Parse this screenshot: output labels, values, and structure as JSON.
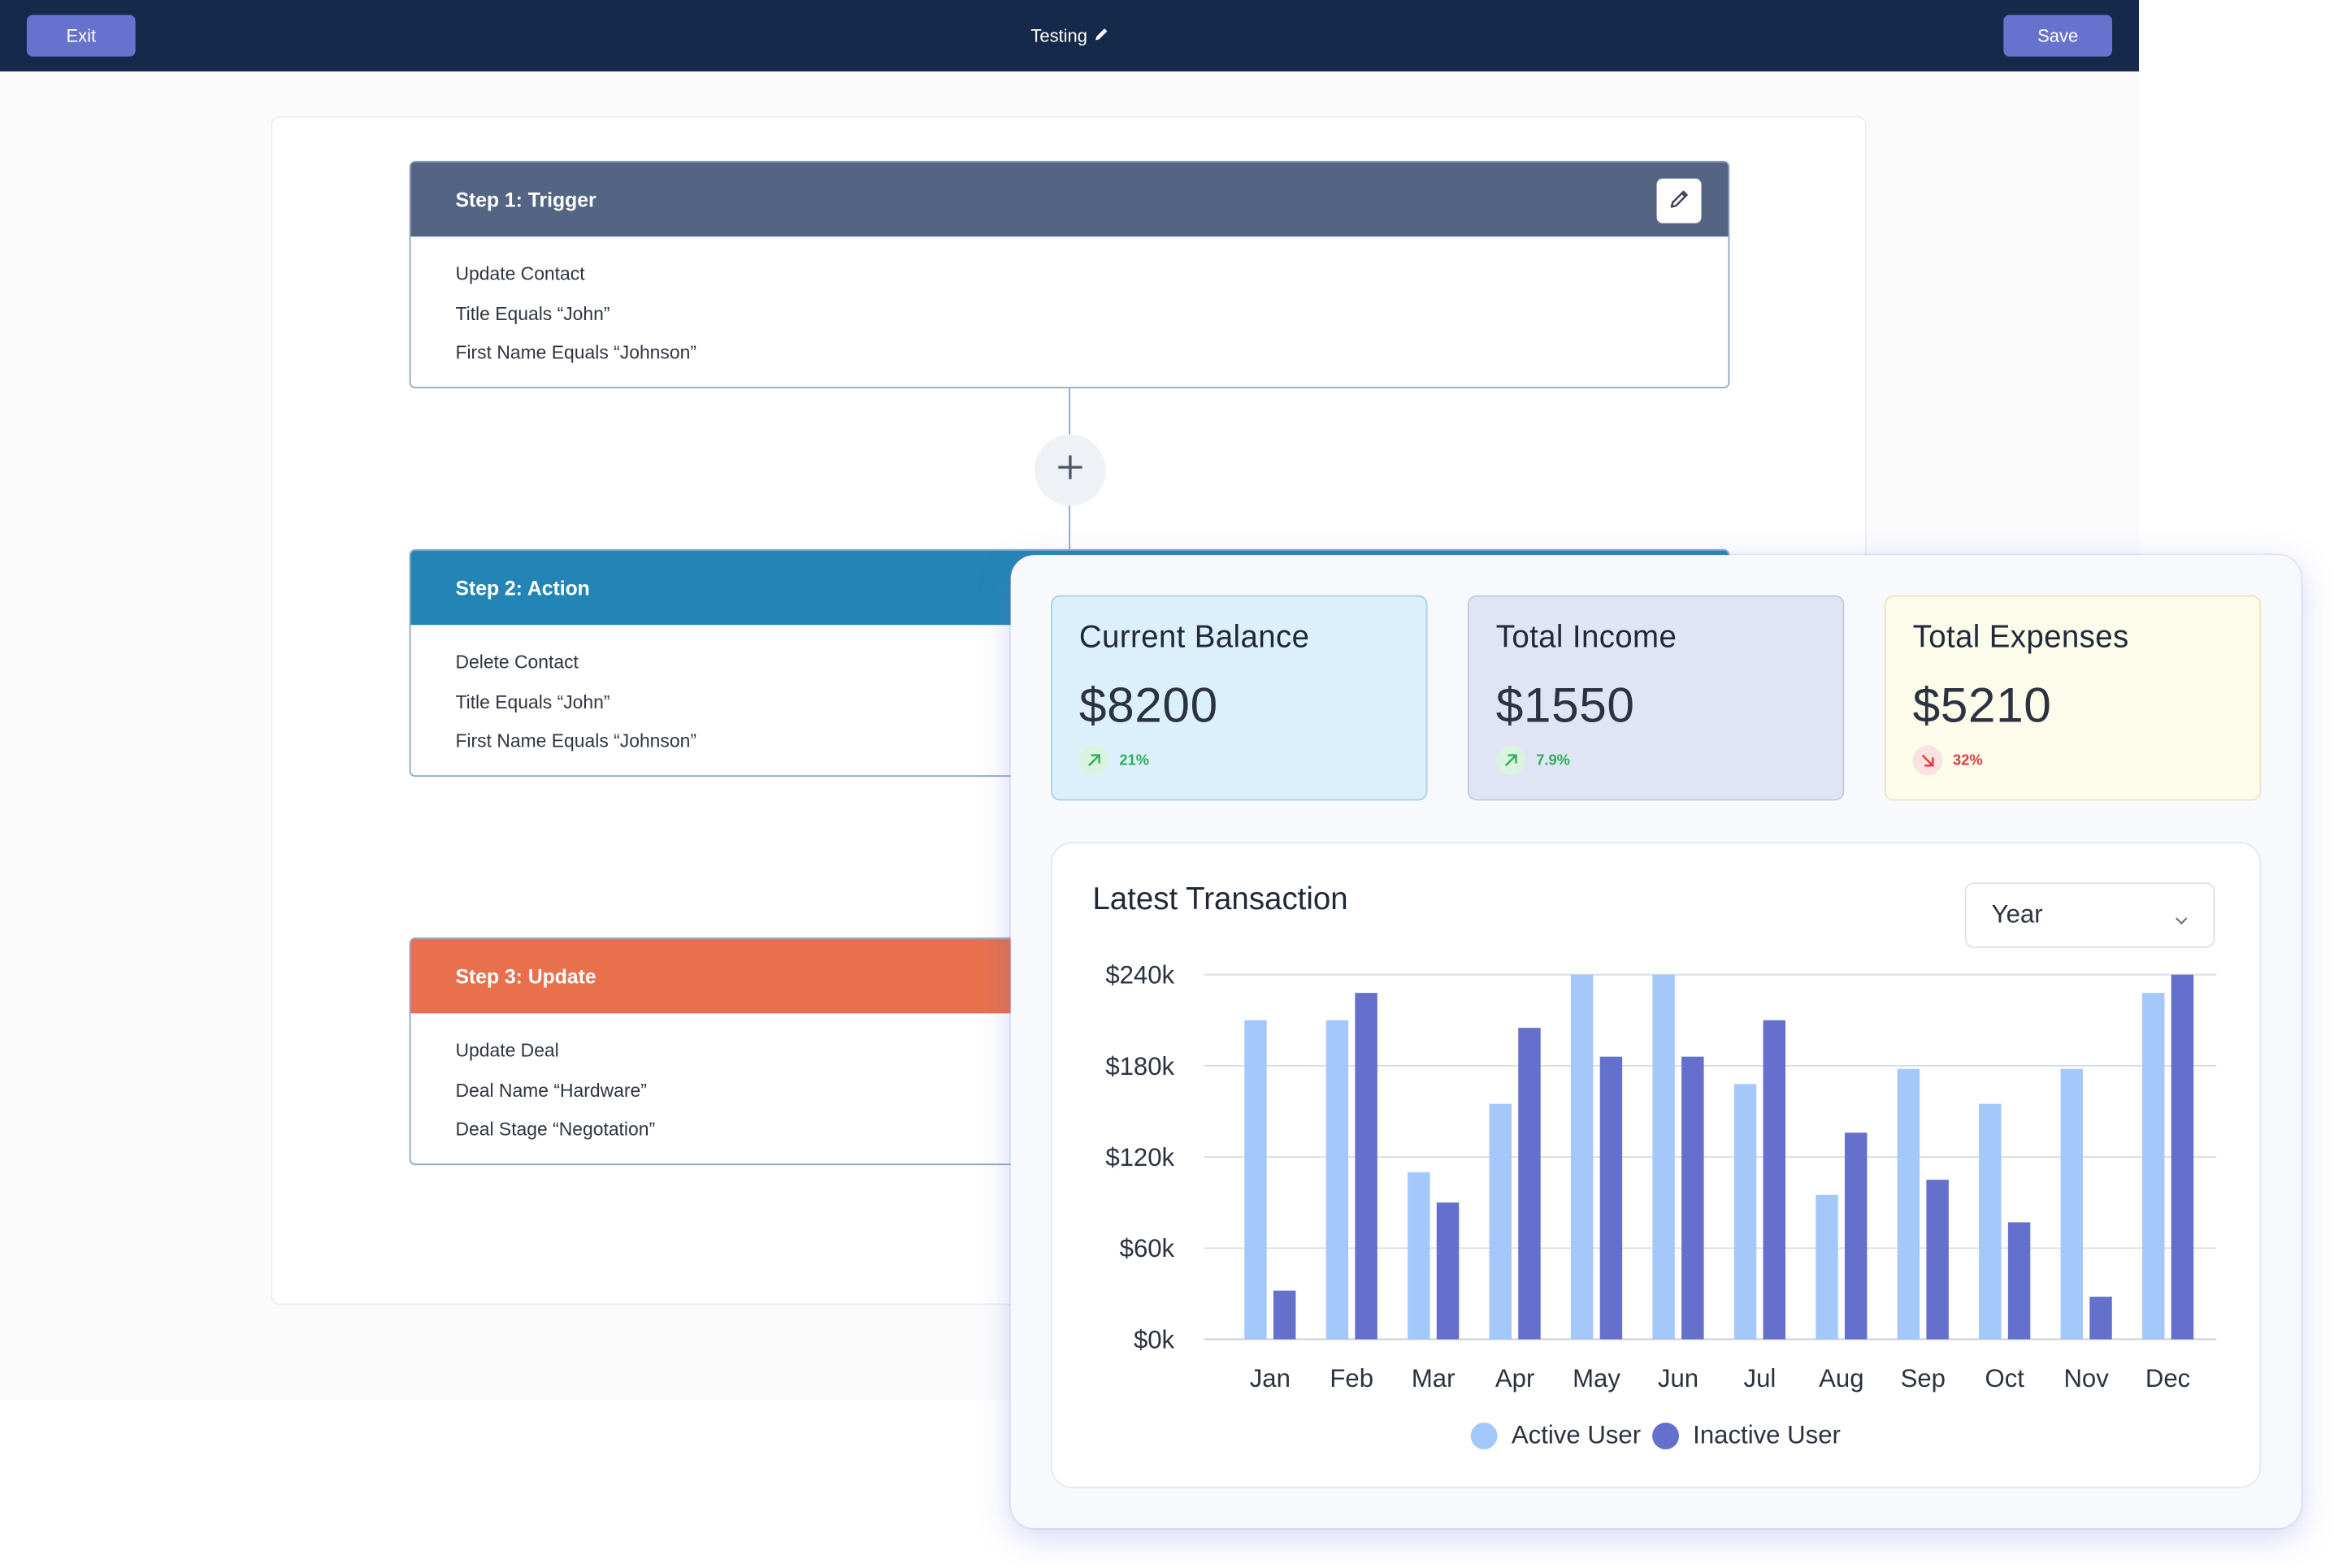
{
  "topbar": {
    "exit_label": "Exit",
    "title": "Testing",
    "save_label": "Save"
  },
  "workflow": {
    "steps": [
      {
        "title": "Step 1: Trigger",
        "color": "#546583",
        "lines": [
          "Update Contact",
          "Title Equals “John”",
          "First Name Equals “Johnson”"
        ]
      },
      {
        "title": "Step 2: Action",
        "color": "#2385b5",
        "lines": [
          "Delete Contact",
          "Title Equals “John”",
          "First Name Equals “Johnson”"
        ]
      },
      {
        "title": "Step 3: Update",
        "color": "#e8704d",
        "lines": [
          "Update Deal",
          "Deal Name “Hardware”",
          "Deal Stage “Negotation”"
        ]
      }
    ]
  },
  "stats": [
    {
      "title": "Current Balance",
      "value": "$8200",
      "change": "21%",
      "direction": "up",
      "bg": "#dcf0fb",
      "border": "#a8cfe9",
      "trend_color": "#2eae55"
    },
    {
      "title": "Total Income",
      "value": "$1550",
      "change": "7.9%",
      "direction": "up",
      "bg": "#e0e5f5",
      "border": "#c2c9e0",
      "trend_color": "#2eae55"
    },
    {
      "title": "Total Expenses",
      "value": "$5210",
      "change": "32%",
      "direction": "down",
      "bg": "#fdfbea",
      "border": "#ece6c2",
      "trend_color": "#e03a3a"
    }
  ],
  "transactions": {
    "title": "Latest Transaction",
    "period_select": "Year"
  },
  "chart_data": {
    "type": "bar",
    "title": "Latest Transaction",
    "categories": [
      "Jan",
      "Feb",
      "Mar",
      "Apr",
      "May",
      "Jun",
      "Jul",
      "Aug",
      "Sep",
      "Oct",
      "Nov",
      "Dec"
    ],
    "series": [
      {
        "name": "Active User",
        "color": "#a5c8fb",
        "values": [
          210000,
          210000,
          110000,
          155000,
          240000,
          240000,
          168000,
          95000,
          178000,
          155000,
          178000,
          228000
        ]
      },
      {
        "name": "Inactive User",
        "color": "#6470cb",
        "values": [
          32000,
          228000,
          90000,
          205000,
          186000,
          186000,
          210000,
          136000,
          105000,
          77000,
          28000,
          240000
        ]
      }
    ],
    "yticks": [
      "$240k",
      "$180k",
      "$120k",
      "$60k",
      "$0k"
    ],
    "ytick_values": [
      240000,
      180000,
      120000,
      60000,
      0
    ],
    "ylim": [
      0,
      240000
    ],
    "grid": true,
    "legend": "bottom"
  }
}
